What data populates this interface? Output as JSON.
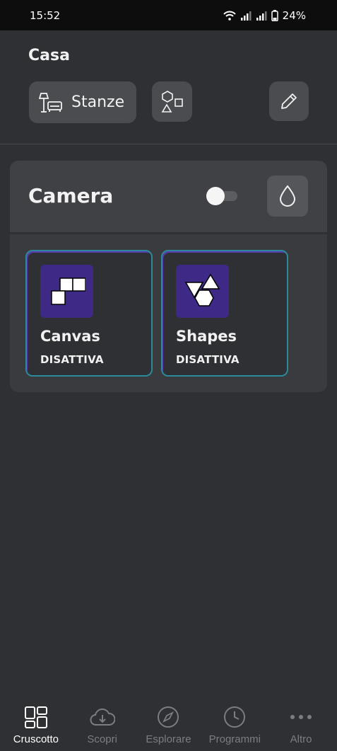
{
  "status_bar": {
    "time": "15:52",
    "battery": "24%"
  },
  "header": {
    "title": "Casa",
    "rooms_button_label": "Stanze"
  },
  "room": {
    "name": "Camera",
    "toggle_on": false
  },
  "tiles": [
    {
      "name": "Canvas",
      "state": "DISATTIVA",
      "icon": "canvas-panels-icon"
    },
    {
      "name": "Shapes",
      "state": "DISATTIVA",
      "icon": "shapes-panels-icon"
    }
  ],
  "bottom_nav": [
    {
      "label": "Cruscotto",
      "icon": "dashboard-icon",
      "active": true
    },
    {
      "label": "Scopri",
      "icon": "cloud-download-icon",
      "active": false
    },
    {
      "label": "Esplorare",
      "icon": "compass-icon",
      "active": false
    },
    {
      "label": "Programmi",
      "icon": "clock-icon",
      "active": false
    },
    {
      "label": "Altro",
      "icon": "more-icon",
      "active": false
    }
  ],
  "colors": {
    "background": "#2f3033",
    "card": "#3a3b3e",
    "tile_icon_bg": "#3e2a86",
    "tile_border": "#2a8a9a"
  }
}
